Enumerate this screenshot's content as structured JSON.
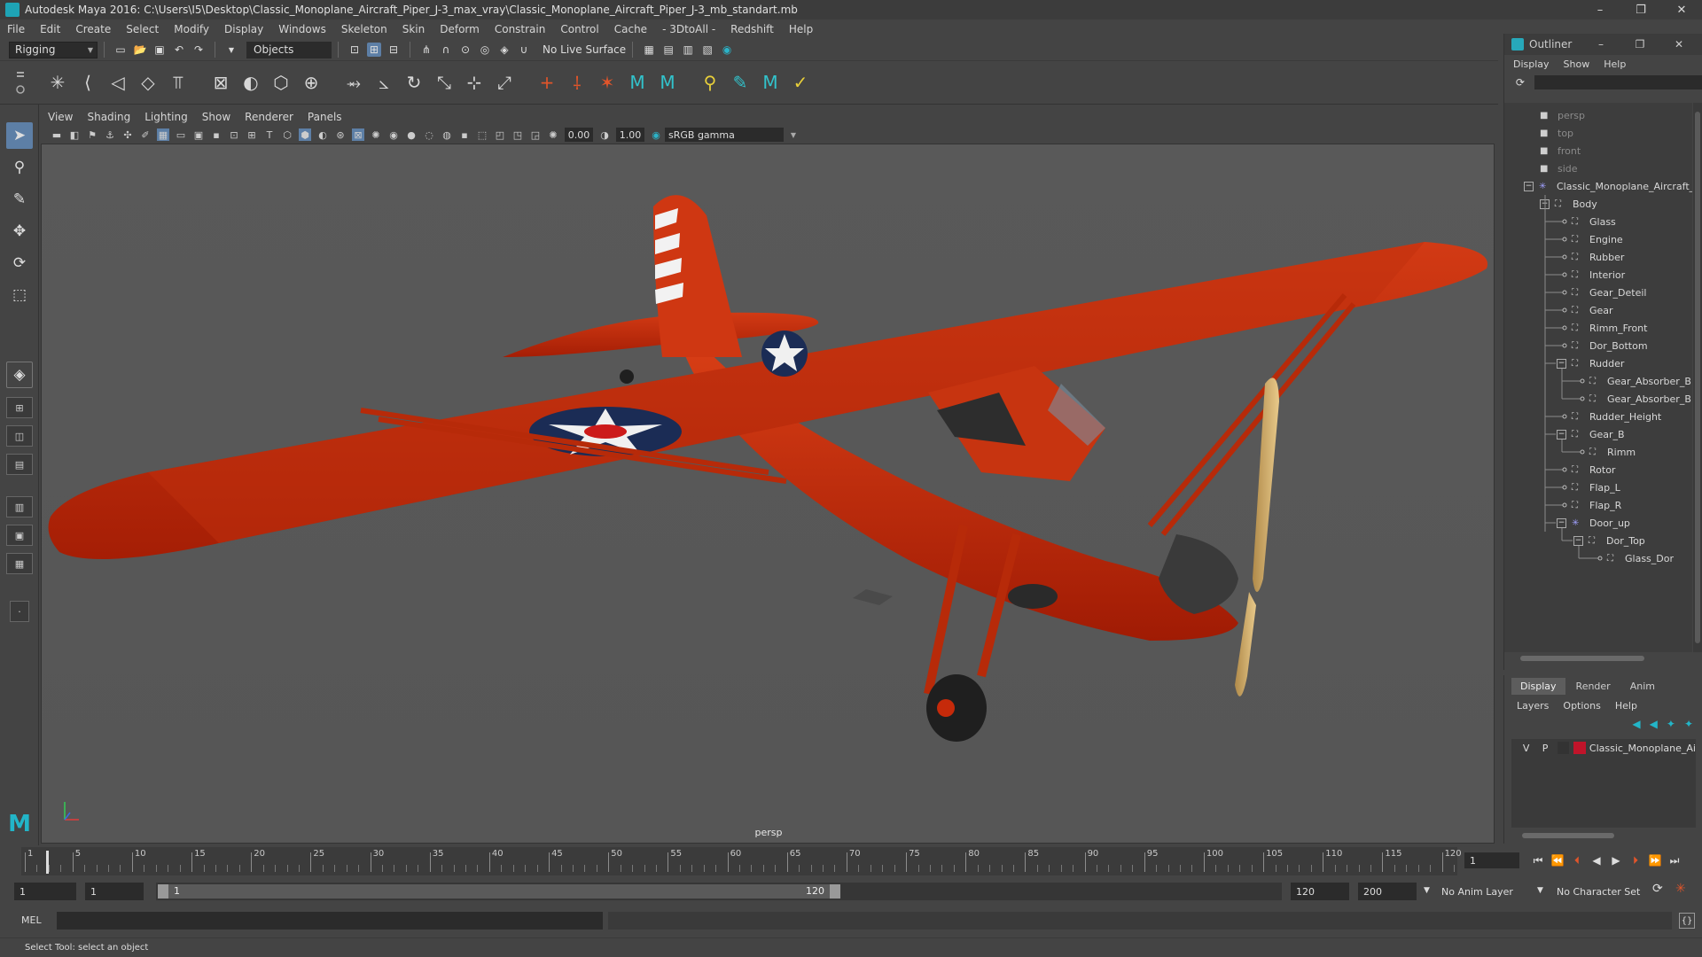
{
  "window": {
    "title": "Autodesk Maya 2016: C:\\Users\\I5\\Desktop\\Classic_Monoplane_Aircraft_Piper_J-3_max_vray\\Classic_Monoplane_Aircraft_Piper_J-3_mb_standart.mb",
    "minimize": "–",
    "restore": "❐",
    "close": "✕"
  },
  "menu": [
    "File",
    "Edit",
    "Create",
    "Select",
    "Modify",
    "Display",
    "Windows",
    "Skeleton",
    "Skin",
    "Deform",
    "Constrain",
    "Control",
    "Cache",
    "- 3DtoAll -",
    "Redshift",
    "Help"
  ],
  "statusline": {
    "mode": "Rigging",
    "selection_mask": "Objects",
    "live_surface": "No Live Surface"
  },
  "viewport": {
    "menu": [
      "View",
      "Shading",
      "Lighting",
      "Show",
      "Renderer",
      "Panels"
    ],
    "exposure": "0.00",
    "gamma": "1.00",
    "color_space": "sRGB gamma",
    "camera": "persp"
  },
  "outliner": {
    "title": "Outliner",
    "menu": [
      "Display",
      "Show",
      "Help"
    ],
    "cameras": [
      "persp",
      "top",
      "front",
      "side"
    ],
    "root": "Classic_Monoplane_Aircraft_I",
    "body": "Body",
    "items": [
      {
        "label": "Glass",
        "depth": 2
      },
      {
        "label": "Engine",
        "depth": 2
      },
      {
        "label": "Rubber",
        "depth": 2
      },
      {
        "label": "Interior",
        "depth": 2
      },
      {
        "label": "Gear_Deteil",
        "depth": 2
      },
      {
        "label": "Gear",
        "depth": 2
      },
      {
        "label": "Rimm_Front",
        "depth": 2
      },
      {
        "label": "Dor_Bottom",
        "depth": 2
      },
      {
        "label": "Rudder",
        "depth": 2,
        "expanded": true
      },
      {
        "label": "Gear_Absorber_B",
        "depth": 3
      },
      {
        "label": "Gear_Absorber_B",
        "depth": 3
      },
      {
        "label": "Rudder_Height",
        "depth": 2
      },
      {
        "label": "Gear_B",
        "depth": 2,
        "expanded": true
      },
      {
        "label": "Rimm",
        "depth": 3
      },
      {
        "label": "Rotor",
        "depth": 2
      },
      {
        "label": "Flap_L",
        "depth": 2
      },
      {
        "label": "Flap_R",
        "depth": 2
      },
      {
        "label": "Door_up",
        "depth": 2,
        "expanded": true
      },
      {
        "label": "Dor_Top",
        "depth": 3,
        "expanded": true
      },
      {
        "label": "Glass_Dor",
        "depth": 4
      }
    ]
  },
  "layers": {
    "tabs": [
      "Display",
      "Render",
      "Anim"
    ],
    "menu": [
      "Layers",
      "Options",
      "Help"
    ],
    "row": {
      "v": "V",
      "p": "P",
      "name": "Classic_Monoplane_Ai",
      "color": "#c0142a"
    }
  },
  "timeline": {
    "labels": [
      "1",
      "5",
      "10",
      "15",
      "20",
      "25",
      "30",
      "35",
      "40",
      "45",
      "50",
      "55",
      "60",
      "65",
      "70",
      "75",
      "80",
      "85",
      "90",
      "95",
      "100",
      "105",
      "110",
      "115",
      "120"
    ],
    "current_frame": "1"
  },
  "range": {
    "start": "1",
    "playback_start": "1",
    "handle_start": "1",
    "handle_end": "120",
    "playback_end": "120",
    "end": "200",
    "anim_layer": "No Anim Layer",
    "character_set": "No Character Set"
  },
  "cmdline": {
    "label": "MEL"
  },
  "help": {
    "text": "Select Tool: select an object"
  },
  "colors": {
    "airplane": "#c62a0a",
    "accent": "#5d7fa6",
    "maya_teal": "#22b5c8"
  }
}
